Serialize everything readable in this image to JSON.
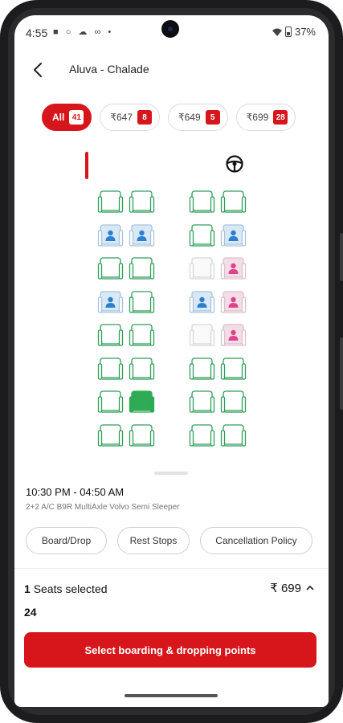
{
  "status_bar": {
    "time": "4:55",
    "battery": "37%"
  },
  "header": {
    "title": "Aluva - Chalade"
  },
  "filters": [
    {
      "label": "All",
      "count": "41",
      "active": true
    },
    {
      "label": "₹647",
      "count": "8",
      "active": false
    },
    {
      "label": "₹649",
      "count": "5",
      "active": false
    },
    {
      "label": "₹699",
      "count": "28",
      "active": false
    }
  ],
  "seat_map": {
    "rows": [
      [
        "available",
        "available",
        "available",
        "available"
      ],
      [
        "booked-male",
        "booked-male",
        "available",
        "booked-male"
      ],
      [
        "available",
        "available",
        "blocked",
        "booked-female"
      ],
      [
        "booked-male",
        "available",
        "booked-male",
        "booked-female"
      ],
      [
        "available",
        "available",
        "blocked",
        "booked-female"
      ],
      [
        "available",
        "available",
        "available",
        "available"
      ],
      [
        "available",
        "selected",
        "available",
        "available"
      ],
      [
        "available",
        "available",
        "available",
        "available"
      ]
    ],
    "colors": {
      "available": "#2f9e5b",
      "selected": "#2faa55",
      "booked_male": "#2a7fd0",
      "booked_female": "#e0428a",
      "accent": "#d7161b"
    }
  },
  "trip": {
    "time": "10:30 PM - 04:50 AM",
    "bus_type": "2+2 A/C B9R MultiAxle Volvo Semi Sleeper"
  },
  "info_tabs": [
    "Board/Drop",
    "Rest Stops",
    "Cancellation Policy"
  ],
  "selection": {
    "count": "1",
    "label": "Seats selected",
    "fare": "₹ 699",
    "seat_number": "24"
  },
  "cta_label": "Select boarding & dropping points"
}
